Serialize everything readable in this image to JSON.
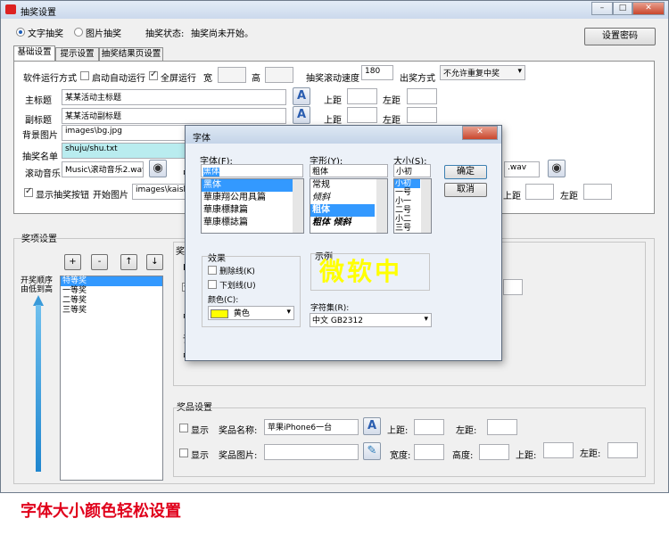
{
  "window": {
    "title": "抽奖设置",
    "controls": {
      "min": "–",
      "max": "□",
      "close": "✕"
    }
  },
  "top": {
    "mode_text": "文字抽奖",
    "mode_image": "图片抽奖",
    "status_label": "抽奖状态:",
    "status_value": "抽奖尚未开始。",
    "password_button": "设置密码"
  },
  "tabs": [
    "基础设置",
    "提示设置",
    "抽奖结果页设置"
  ],
  "basic": {
    "run_mode_label": "软件运行方式",
    "auto_start": "启动自动运行",
    "fullscreen": "全屏运行",
    "width_label": "宽",
    "height_label": "高",
    "scroll_speed_label": "抽奖滚动速度",
    "scroll_speed_value": "180",
    "out_mode_label": "出奖方式",
    "out_mode_value": "不允许重复中奖",
    "main_title_label": "主标题",
    "main_title_value": "某某活动主标题",
    "sub_title_label": "副标题",
    "sub_title_value": "某某活动副标题",
    "top_label": "上距",
    "left_label": "左距",
    "bg_label": "背景图片",
    "bg_value": "images\\bg.jpg",
    "list_label": "抽奖名单",
    "list_value": "shuju/shu.txt",
    "music_label": "滚动音乐",
    "music_value": "Music\\滚动音乐2.wav",
    "music_value_right": ".wav",
    "show_button_label": "显示抽奖按钮",
    "start_image_label": "开始图片",
    "start_image_value": "images\\kaishi"
  },
  "prize": {
    "section_title": "奖项设置",
    "tool_buttons": [
      "+",
      "-",
      "↑",
      "↓"
    ],
    "order_label_1": "开奖顺序",
    "order_label_2": "由低到高",
    "items": [
      "特等奖",
      "一等奖",
      "二等奖",
      "三等奖"
    ],
    "selected_index": 0,
    "clipped_labels": [
      "奖",
      "I",
      "中",
      "该",
      "中"
    ]
  },
  "goods": {
    "section_title": "奖品设置",
    "show_label": "显示",
    "name_label": "奖品名称:",
    "name_value": "苹果iPhone6一台",
    "image_label": "奖品图片:",
    "width_label": "宽度:",
    "height_label": "高度:",
    "top_label": "上距:",
    "left_label": "左距:"
  },
  "font_dialog": {
    "title": "字体",
    "close": "✕",
    "font_label": "字体(F):",
    "font_value": "黑体",
    "font_list": [
      "黑体",
      "華康翔公用具篇",
      "華康標隸篇",
      "華康標誌篇"
    ],
    "style_label": "字形(Y):",
    "style_value": "粗体",
    "style_list": [
      "常规",
      "倾斜",
      "粗体",
      "粗体 倾斜"
    ],
    "size_label": "大小(S):",
    "size_value": "小初",
    "size_list": [
      "小初",
      "一号",
      "小一",
      "二号",
      "小二",
      "三号"
    ],
    "ok": "确定",
    "cancel": "取消",
    "effects_label": "效果",
    "strike_label": "删除线(K)",
    "underline_label": "下划线(U)",
    "color_label": "颜色(C):",
    "color_value": "黄色",
    "color_hex": "#ffff00",
    "sample_label": "示例",
    "sample_text": "微软中",
    "charset_label": "字符集(R):",
    "charset_value": "中文 GB2312"
  },
  "caption": "字体大小颜色轻松设置",
  "colors": {
    "accent": "#3399ff",
    "caption": "#e0001b",
    "sample": "#ffff00"
  }
}
